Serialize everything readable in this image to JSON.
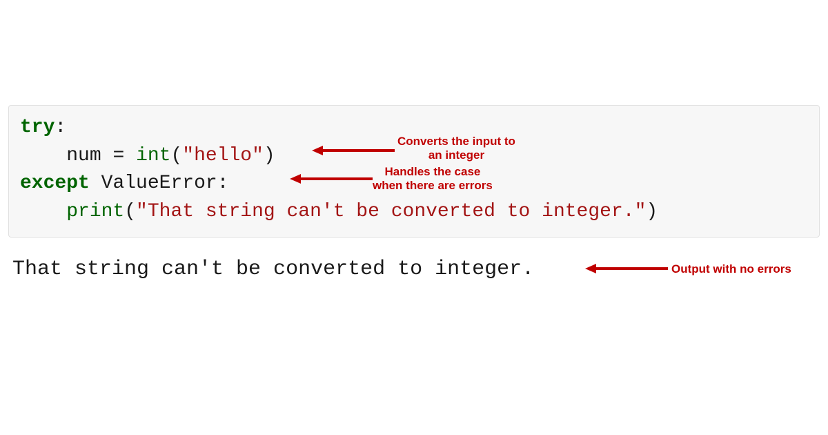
{
  "code": {
    "line1": {
      "try": "try",
      "colon": ":"
    },
    "line2": {
      "indent": "    ",
      "var": "num",
      "eq": " = ",
      "fn": "int",
      "open": "(",
      "str": "\"hello\"",
      "close": ")"
    },
    "line3": {
      "except": "except",
      "space": " ",
      "error": "ValueError",
      "colon": ":"
    },
    "line4": {
      "indent": "    ",
      "fn": "print",
      "open": "(",
      "str": "\"That string can't be converted to integer.\"",
      "close": ")"
    }
  },
  "output": "That string can't be converted to integer.",
  "annotations": {
    "annot1": "Converts the input to\nan integer",
    "annot2": "Handles the case\nwhen there are errors",
    "annot3": "Output with no errors"
  },
  "colors": {
    "annotation": "#c00000",
    "keyword": "#006400",
    "string": "#a31515",
    "code_bg": "#f7f7f7"
  }
}
